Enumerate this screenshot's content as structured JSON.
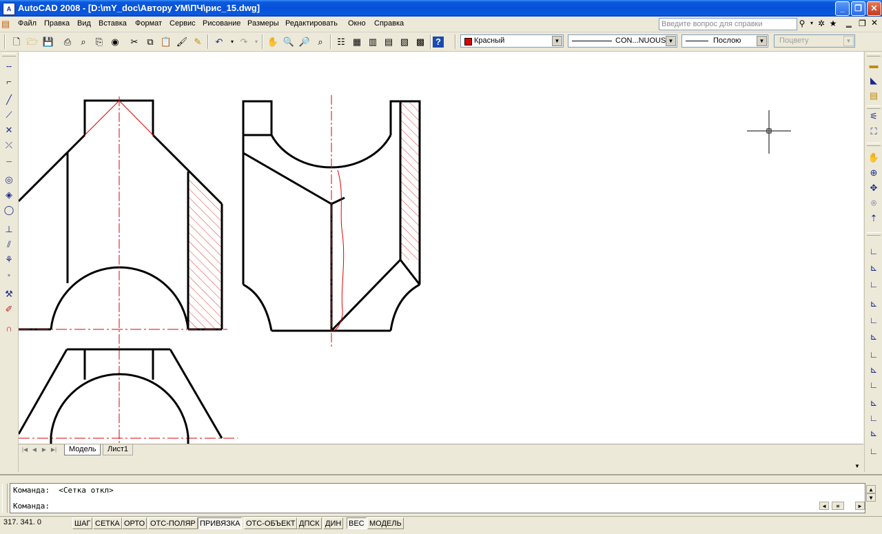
{
  "window": {
    "title": "AutoCAD 2008 - [D:\\mY_doc\\Автору УМ\\ПЧ\\рис_15.dwg]",
    "app_icon_text": "A",
    "minimize": "_",
    "maximize": "❐",
    "close": "✕"
  },
  "menu": {
    "items": [
      "Файл",
      "Правка",
      "Вид",
      "Вставка",
      "Формат",
      "Сервис",
      "Рисование",
      "Размеры",
      "Редактировать",
      "Окно",
      "Справка"
    ],
    "help_placeholder": "Введите вопрос для справки"
  },
  "toolbar": {
    "color_combo": "Красный",
    "linetype_combo": "CON...NUOUS",
    "lineweight_combo": "Послою",
    "plotstyle_combo": "Поцвету",
    "accent_color": "#e00000"
  },
  "tabs": {
    "model": "Модель",
    "layout": "Лист1"
  },
  "command": {
    "line1": "Команда:  <Сетка откл>",
    "line2": "Команда:"
  },
  "status": {
    "coords": "317. 341. 0",
    "buttons": [
      {
        "label": "ШАГ",
        "state": "off"
      },
      {
        "label": "СЕТКА",
        "state": "off"
      },
      {
        "label": "ОРТО",
        "state": "off"
      },
      {
        "label": "ОТС-ПОЛЯР",
        "state": "off"
      },
      {
        "label": "ПРИВЯЗКА",
        "state": "on"
      },
      {
        "label": "ОТС-ОБЪЕКТ",
        "state": "off"
      },
      {
        "label": "ДПСК",
        "state": "off"
      },
      {
        "label": "ДИН",
        "state": "off"
      },
      {
        "label": "ВЕС",
        "state": "on"
      },
      {
        "label": "МОДЕЛЬ",
        "state": "off"
      }
    ]
  },
  "icons": {
    "left_toolbar": [
      "line-icon",
      "ray-icon",
      "construction-line-icon",
      "polyline-icon",
      "multiline-icon",
      "xline-icon",
      "point-divider-icon",
      "circle-icon",
      "ellipse-icon",
      "arc-icon",
      "spline-icon",
      "hatch-icon",
      "insert-block-icon",
      "point-icon",
      "edit-icon",
      "properties-icon",
      "magnet-icon"
    ],
    "right_toolbar": [
      "dim-linear-icon",
      "dim-aligned-icon",
      "dim-style-icon",
      "layer-icon",
      "zoom-in-icon",
      "pan-icon",
      "orbit-icon",
      "walk-icon",
      "ucs-icon",
      "ucs-world-icon",
      "ucs-prev-icon",
      "ucs-face-icon",
      "ucs-object-icon",
      "ucs-view-icon",
      "ucs-origin-icon",
      "ucs-z-icon",
      "ucs-3point-icon",
      "ucs-x-icon",
      "ucs-y-icon",
      "ucs-apply-icon"
    ]
  }
}
